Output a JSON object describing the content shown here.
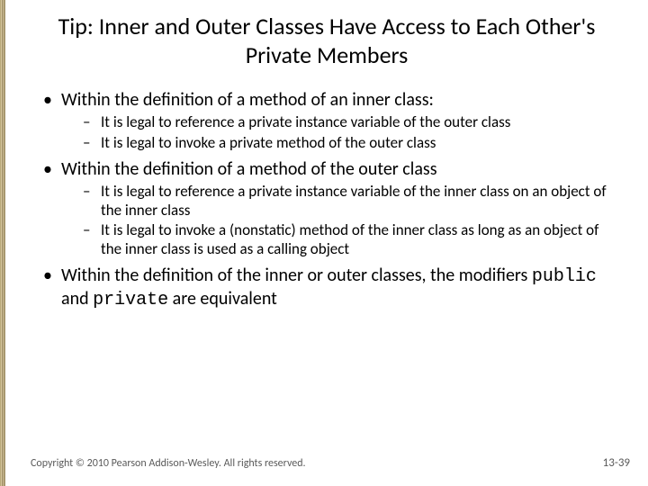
{
  "title": "Tip:  Inner and Outer Classes Have Access to Each Other's Private Members",
  "bullets": [
    {
      "text": "Within the definition of a method of an inner class:",
      "sub": [
        "It is legal to reference a private instance variable of the outer class",
        "It is legal to invoke a private method of the outer class"
      ]
    },
    {
      "text": "Within the definition of a method of the outer class",
      "sub": [
        "It is legal to reference a private instance variable of the inner class on an object of the inner class",
        "It is legal to invoke a (nonstatic) method of the inner class as long as an object of the inner class is used as a calling object"
      ]
    },
    {
      "text_pre": "Within the definition of the inner or outer classes, the modifiers ",
      "code1": "public",
      "mid": " and ",
      "code2": "private",
      "text_post": " are equivalent",
      "sub": []
    }
  ],
  "footer": {
    "copyright": "Copyright © 2010 Pearson Addison-Wesley. All rights reserved.",
    "pagenum": "13-39"
  }
}
